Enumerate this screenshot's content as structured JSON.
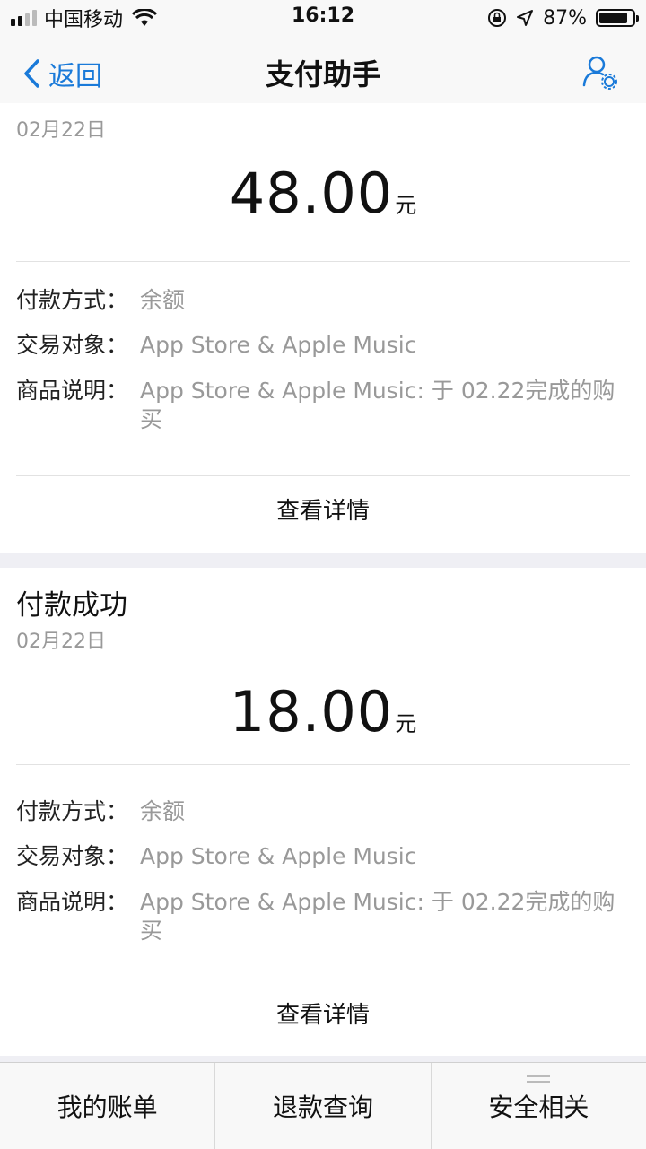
{
  "status_bar": {
    "carrier": "中国移动",
    "time": "16:12",
    "battery_pct": "87%",
    "battery_level": 0.87
  },
  "nav": {
    "back_label": "返回",
    "title": "支付助手"
  },
  "cards": [
    {
      "title": "",
      "date": "02月22日",
      "amount": "48.00",
      "unit": "元",
      "rows": [
        {
          "key": "付款方式：",
          "value": "余额"
        },
        {
          "key": "交易对象：",
          "value": "App Store & Apple Music"
        },
        {
          "key": "商品说明：",
          "value": "App Store & Apple Music: 于 02.22完成的购买"
        }
      ],
      "detail_label": "查看详情"
    },
    {
      "title": "付款成功",
      "date": "02月22日",
      "amount": "18.00",
      "unit": "元",
      "rows": [
        {
          "key": "付款方式：",
          "value": "余额"
        },
        {
          "key": "交易对象：",
          "value": "App Store & Apple Music"
        },
        {
          "key": "商品说明：",
          "value": "App Store & Apple Music: 于 02.22完成的购买"
        }
      ],
      "detail_label": "查看详情"
    }
  ],
  "tabs": [
    {
      "label": "我的账单"
    },
    {
      "label": "退款查询"
    },
    {
      "label": "安全相关"
    }
  ],
  "colors": {
    "accent": "#1a7ad9",
    "muted": "#999999"
  }
}
